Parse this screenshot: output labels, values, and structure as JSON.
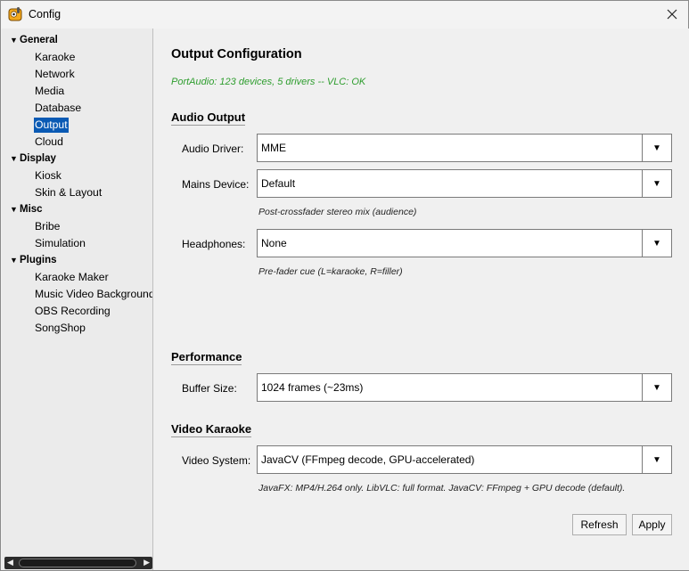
{
  "window": {
    "title": "Config"
  },
  "sidebar": {
    "groups": [
      {
        "label": "General",
        "items": [
          "Karaoke",
          "Network",
          "Media",
          "Database",
          "Output",
          "Cloud"
        ]
      },
      {
        "label": "Display",
        "items": [
          "Kiosk",
          "Skin & Layout"
        ]
      },
      {
        "label": "Misc",
        "items": [
          "Bribe",
          "Simulation"
        ]
      },
      {
        "label": "Plugins",
        "items": [
          "Karaoke Maker",
          "Music Video Background",
          "OBS Recording",
          "SongShop"
        ]
      }
    ],
    "selected": "Output"
  },
  "main": {
    "title": "Output Configuration",
    "status": "PortAudio: 123 devices, 5 drivers -- VLC: OK",
    "status_color": "#2e9d2e",
    "audio_section": "Audio Output",
    "audio_driver": {
      "label": "Audio Driver:",
      "value": "MME"
    },
    "mains_device": {
      "label": "Mains Device:",
      "value": "Default",
      "hint": "Post-crossfader stereo mix (audience)"
    },
    "headphones": {
      "label": "Headphones:",
      "value": "None",
      "hint": "Pre-fader cue (L=karaoke, R=filler)"
    },
    "performance_section": "Performance",
    "buffer_size": {
      "label": "Buffer Size:",
      "value": "1024 frames (~23ms)"
    },
    "video_section": "Video Karaoke",
    "video_system": {
      "label": "Video System:",
      "value": "JavaCV (FFmpeg decode, GPU-accelerated)",
      "hint": "JavaFX: MP4/H.264 only. LibVLC: full format. JavaCV: FFmpeg + GPU decode (default)."
    },
    "refresh_label": "Refresh",
    "apply_label": "Apply"
  },
  "colors": {
    "selection": "#0a5ab4",
    "status": "#2e9d2e"
  }
}
